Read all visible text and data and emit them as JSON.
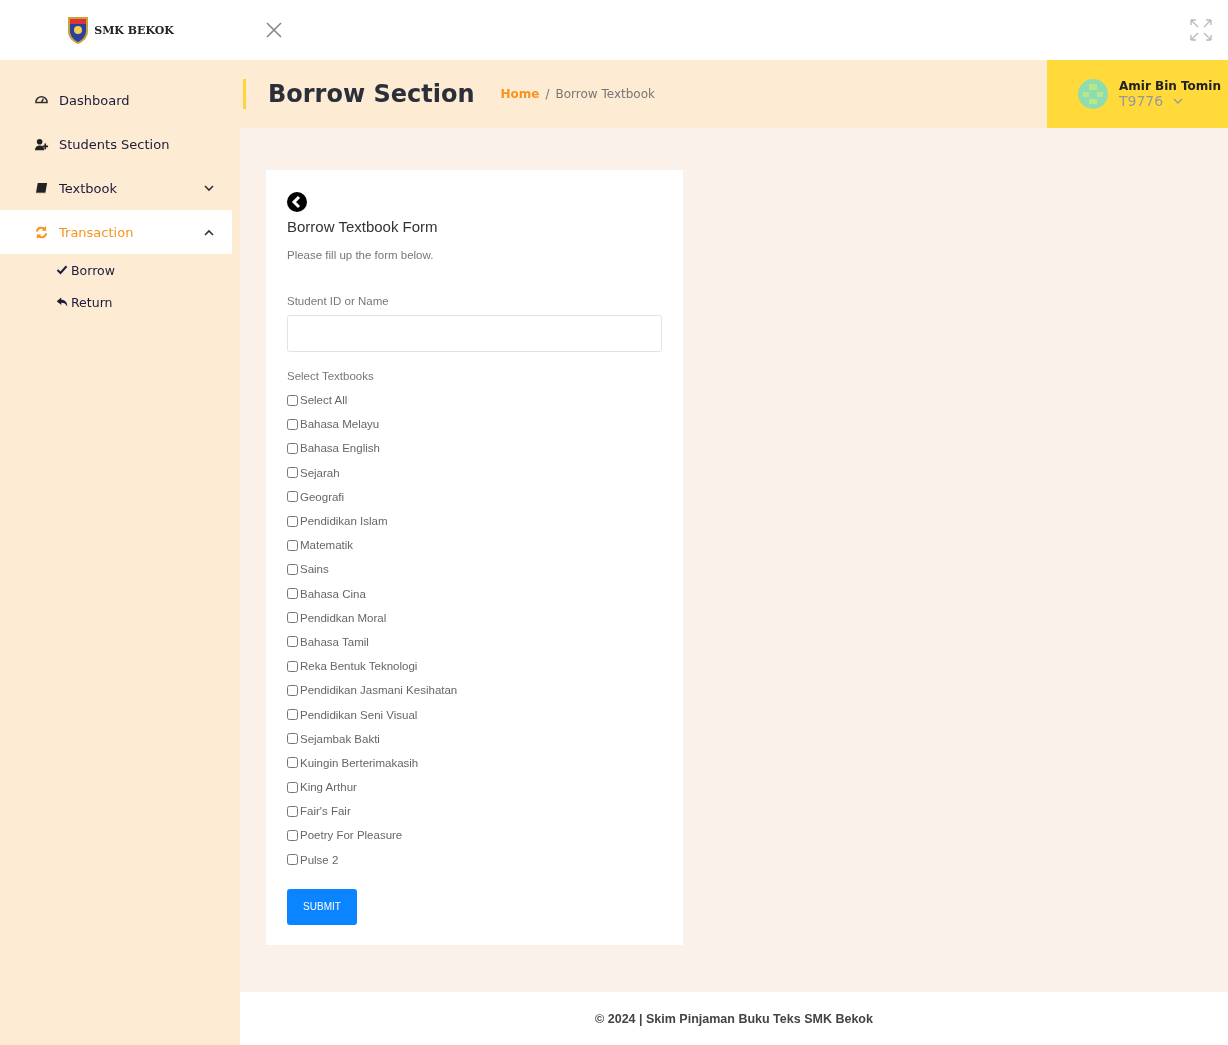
{
  "brand": {
    "name": "SMK BEKOK"
  },
  "sidebar": {
    "items": [
      {
        "label": "Dashboard",
        "selected": false
      },
      {
        "label": "Students Section",
        "selected": false
      },
      {
        "label": "Textbook",
        "selected": false,
        "expanded": false
      },
      {
        "label": "Transaction",
        "selected": true,
        "expanded": true,
        "children": [
          {
            "label": "Borrow"
          },
          {
            "label": "Return"
          }
        ]
      }
    ]
  },
  "header": {
    "title": "Borrow Section",
    "breadcrumb": [
      "Home",
      "Borrow Textbook"
    ],
    "breadcrumb_separator": "/",
    "user": {
      "name": "Amir Bin Tomin",
      "id": "T9776"
    }
  },
  "form": {
    "title": "Borrow Textbook Form",
    "subtitle": "Please fill up the form below.",
    "student_label": "Student ID or Name",
    "textbooks_label": "Select Textbooks",
    "options": [
      {
        "label": "Select All",
        "checked": false
      },
      {
        "label": "Bahasa Melayu",
        "checked": false
      },
      {
        "label": "Bahasa English",
        "checked": false
      },
      {
        "label": "Sejarah",
        "checked": false
      },
      {
        "label": "Geografi",
        "checked": false
      },
      {
        "label": "Pendidikan Islam",
        "checked": false
      },
      {
        "label": "Matematik",
        "checked": false
      },
      {
        "label": "Sains",
        "checked": false
      },
      {
        "label": "Bahasa Cina",
        "checked": false
      },
      {
        "label": "Pendidkan Moral",
        "checked": false
      },
      {
        "label": "Bahasa Tamil",
        "checked": false
      },
      {
        "label": "Reka Bentuk Teknologi",
        "checked": false
      },
      {
        "label": "Pendidikan Jasmani Kesihatan",
        "checked": false
      },
      {
        "label": "Pendidikan Seni Visual",
        "checked": false
      },
      {
        "label": "Sejambak Bakti",
        "checked": false
      },
      {
        "label": "Kuingin Berterimakasih",
        "checked": false
      },
      {
        "label": "King Arthur",
        "checked": false
      },
      {
        "label": "Fair's Fair",
        "checked": false
      },
      {
        "label": "Poetry For Pleasure",
        "checked": false
      },
      {
        "label": "Pulse 2",
        "checked": false
      }
    ],
    "submit": "SUBMIT"
  },
  "footer": "© 2024 | Skim Pinjaman Buku Teks SMK Bekok"
}
